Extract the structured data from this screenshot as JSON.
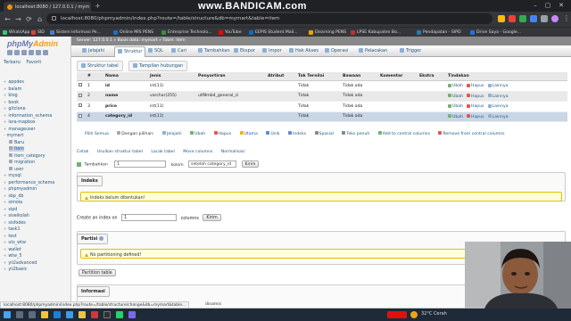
{
  "browser": {
    "tabs": [
      {
        "title": "localhost:8080 / 127.0.0.1 / mym"
      }
    ],
    "url": "localhost:8080/phpmyadmin/index.php?route=/table/structure&db=mymart&table=item",
    "bookmarks": [
      "WhatsApp",
      "SID",
      "Sistem Informasi Pe...",
      "Online MIS PENS",
      "Enterprise Technolo...",
      "YouTube",
      "EEPIS Student Mail...",
      "Elearning PENS",
      "LPSE Kabupaten Bo...",
      "Pendapatan - SIPD",
      "Drive Saya - Google..."
    ],
    "status_url": "localhost:8080/phpmyadmin/index.php?route=/table/structure/change&db=mymart&table..."
  },
  "watermark": "www.BANDICAM.com",
  "sidebar": {
    "logo_main": "phpMy",
    "logo_accent": "Admin",
    "tabs": [
      "Terbaru",
      "Favorit"
    ],
    "databases": [
      {
        "name": "appdes",
        "open": false
      },
      {
        "name": "balam",
        "open": false
      },
      {
        "name": "blog",
        "open": false
      },
      {
        "name": "book",
        "open": false
      },
      {
        "name": "gitclone",
        "open": false
      },
      {
        "name": "information_schema",
        "open": false
      },
      {
        "name": "lara-mapbox",
        "open": false
      },
      {
        "name": "manageuser",
        "open": false
      },
      {
        "name": "mymart",
        "open": true
      }
    ],
    "mymart_tables": [
      "Baru",
      "item",
      "item_category",
      "migration",
      "user"
    ],
    "more_databases": [
      "mysql",
      "performance_schema",
      "phpmyadmin",
      "sbp_db",
      "simola",
      "sipd",
      "siseikolah",
      "sisfodes",
      "task1",
      "test",
      "uts_wtw",
      "wallet",
      "wtw_5",
      "yii2advanced",
      "yii2basic"
    ]
  },
  "pma": {
    "breadcrumb": "Server: 127.0.0.1 » Basis data: mymart » Tabel: item",
    "menu": [
      "Jelajahi",
      "Struktur",
      "SQL",
      "Cari",
      "Tambahkan",
      "Ekspor",
      "Impor",
      "Hak Akses",
      "Operasi",
      "Pelacakan",
      "Trigger"
    ],
    "active_menu": "Struktur",
    "subtabs": [
      "Struktur tabel",
      "Tampilan hubungan"
    ],
    "table_headers": [
      "#",
      "Nama",
      "Jenis",
      "Penyortiran",
      "Atribut",
      "Tak Ternilai",
      "Bawaan",
      "Komentar",
      "Ekstra",
      "Tindakan"
    ],
    "rows": [
      {
        "num": "1",
        "name": "id",
        "type": "int(11)",
        "collation": "",
        "null": "Tidak",
        "default": "Tidak ada"
      },
      {
        "num": "2",
        "name": "name",
        "type": "varchar(255)",
        "collation": "utf8mb4_general_ci",
        "null": "Tidak",
        "default": "Tidak ada"
      },
      {
        "num": "3",
        "name": "price",
        "type": "int(11)",
        "collation": "",
        "null": "Tidak",
        "default": "Tidak ada"
      },
      {
        "num": "4",
        "name": "category_id",
        "type": "int(11)",
        "collation": "",
        "null": "Tidak",
        "default": "Tidak ada"
      }
    ],
    "row_actions": {
      "edit": "Ubah",
      "drop": "Hapus",
      "more": "Lainnya"
    },
    "bulk": {
      "check_all": "Pilih Semua",
      "with_selected": "Dengan pilihan:",
      "browse": "Jelajahi",
      "edit": "Ubah",
      "drop": "Hapus",
      "primary": "Utama",
      "unique": "Unik",
      "index": "Indeks",
      "spatial": "Spasial",
      "fulltext": "Teks penuh",
      "add_central": "Add to central columns",
      "remove_central": "Remove from central columns"
    },
    "tools": {
      "print": "Cetak",
      "propose": "Usulkan struktur tabel",
      "track": "Lacak tabel",
      "move": "Move columns",
      "normalize": "Normalisasi"
    },
    "add_column": {
      "label": "Tambahkan",
      "count": "1",
      "unit": "kolom",
      "position": "setelah category_id",
      "go": "Kirim"
    },
    "indexes": {
      "title": "Indeks",
      "notice": "Indeks belum ditentukan!",
      "create_prefix": "Create an index on",
      "create_count": "1",
      "create_suffix": "columns",
      "go": "Kirim"
    },
    "partitions": {
      "title": "Partisi",
      "notice": "No partitioning defined!",
      "partition_table": "Partition table"
    },
    "information": {
      "title": "Informasi"
    },
    "bottom_text": "dinamis"
  },
  "taskbar": {
    "weather": "32°C Cerah"
  }
}
